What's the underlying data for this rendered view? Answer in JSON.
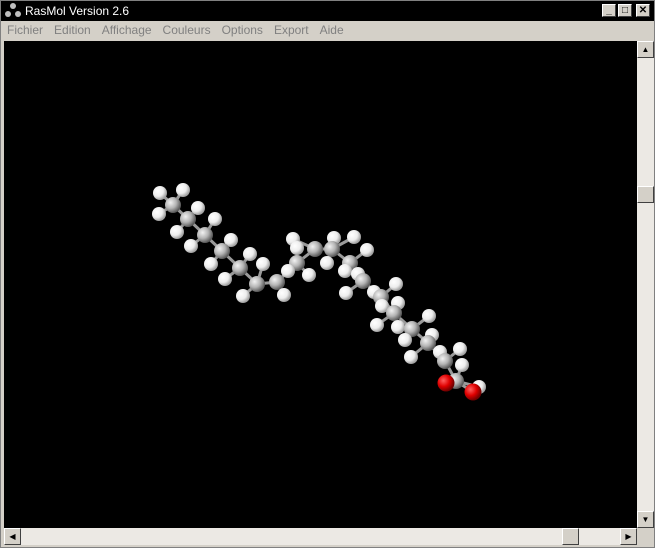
{
  "window": {
    "title": "RasMol Version 2.6",
    "minimize_label": "_",
    "maximize_label": "□",
    "close_label": "✕"
  },
  "menu": {
    "items": [
      "Fichier",
      "Edition",
      "Affichage",
      "Couleurs",
      "Options",
      "Export",
      "Aide"
    ]
  },
  "scrollbars": {
    "up_arrow": "▲",
    "down_arrow": "▼",
    "left_arrow": "◀",
    "right_arrow": "▶"
  },
  "colors": {
    "viewport_background": "#000000",
    "carbon": "#b4b4b4",
    "hydrogen": "#f0f0f0",
    "oxygen": "#e00000",
    "titlebar": "#000000",
    "menu_text_disabled": "#808080"
  },
  "molecule": {
    "representation": "ball-and-stick",
    "atom_types": [
      "C",
      "H",
      "O"
    ]
  }
}
